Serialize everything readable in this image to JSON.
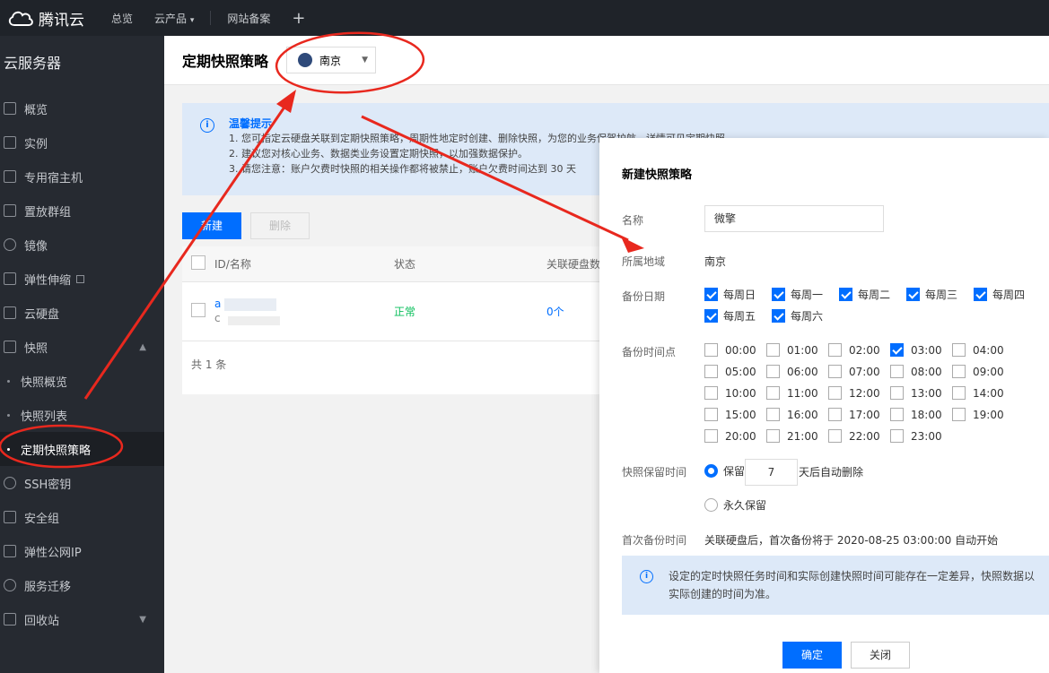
{
  "topbar": {
    "brand": "腾讯云",
    "nav": [
      {
        "label": "总览",
        "icon": ""
      },
      {
        "label": "云产品",
        "icon": "chevron-down-icon"
      },
      {
        "label": "网站备案",
        "icon": ""
      }
    ],
    "plus_icon": "plus-icon"
  },
  "sidebar": {
    "title": "云服务器",
    "items": [
      {
        "label": "概览",
        "icon": "grid-icon"
      },
      {
        "label": "实例",
        "icon": "cube-icon"
      },
      {
        "label": "专用宿主机",
        "icon": "layers-icon"
      },
      {
        "label": "置放群组",
        "icon": "group-icon"
      },
      {
        "label": "镜像",
        "icon": "disc-icon"
      },
      {
        "label": "弹性伸缩",
        "icon": "scale-icon"
      },
      {
        "label": "云硬盘",
        "icon": "disk-icon"
      },
      {
        "label": "快照",
        "icon": "camera-icon"
      }
    ],
    "snapshot_sub": [
      {
        "label": "快照概览"
      },
      {
        "label": "快照列表"
      },
      {
        "label": "定期快照策略"
      }
    ],
    "items_after": [
      {
        "label": "SSH密钥",
        "icon": "key-icon"
      },
      {
        "label": "安全组",
        "icon": "shield-icon"
      },
      {
        "label": "弹性公网IP",
        "icon": "ip-icon"
      },
      {
        "label": "服务迁移",
        "icon": "migrate-icon"
      },
      {
        "label": "回收站",
        "icon": "trash-icon"
      }
    ]
  },
  "page": {
    "title": "定期快照策略",
    "region": "南京"
  },
  "notice": {
    "title": "温馨提示",
    "lines": [
      "1. 您可指定云硬盘关联到定期快照策略，周期性地定时创建、删除快照，为您的业务保驾护航，详情可见定期快照",
      "2. 建议您对核心业务、数据类业务设置定期快照，以加强数据保护。",
      "3. 请您注意：账户欠费时快照的相关操作都将被禁止，账户欠费时间达到 30 天"
    ]
  },
  "actions": {
    "create": "新建",
    "delete": "删除"
  },
  "table": {
    "headers": [
      "ID/名称",
      "状态",
      "关联硬盘数"
    ],
    "rows": [
      {
        "id_prefix": "a",
        "name_prefix": "c",
        "status": "正常",
        "disks": "0个"
      }
    ],
    "footer": "共 1 条"
  },
  "modal": {
    "title": "新建快照策略",
    "name_label": "名称",
    "name_value": "微擎",
    "region_label": "所属地域",
    "region_value": "南京",
    "days_label": "备份日期",
    "days": [
      {
        "label": "每周日",
        "checked": true
      },
      {
        "label": "每周一",
        "checked": true
      },
      {
        "label": "每周二",
        "checked": true
      },
      {
        "label": "每周三",
        "checked": true
      },
      {
        "label": "每周四",
        "checked": true
      },
      {
        "label": "每周五",
        "checked": true
      },
      {
        "label": "每周六",
        "checked": true
      }
    ],
    "time_label": "备份时间点",
    "times": [
      {
        "label": "00:00",
        "checked": false
      },
      {
        "label": "01:00",
        "checked": false
      },
      {
        "label": "02:00",
        "checked": false
      },
      {
        "label": "03:00",
        "checked": true
      },
      {
        "label": "04:00",
        "checked": false
      },
      {
        "label": "05:00",
        "checked": false
      },
      {
        "label": "06:00",
        "checked": false
      },
      {
        "label": "07:00",
        "checked": false
      },
      {
        "label": "08:00",
        "checked": false
      },
      {
        "label": "09:00",
        "checked": false
      },
      {
        "label": "10:00",
        "checked": false
      },
      {
        "label": "11:00",
        "checked": false
      },
      {
        "label": "12:00",
        "checked": false
      },
      {
        "label": "13:00",
        "checked": false
      },
      {
        "label": "14:00",
        "checked": false
      },
      {
        "label": "15:00",
        "checked": false
      },
      {
        "label": "16:00",
        "checked": false
      },
      {
        "label": "17:00",
        "checked": false
      },
      {
        "label": "18:00",
        "checked": false
      },
      {
        "label": "19:00",
        "checked": false
      },
      {
        "label": "20:00",
        "checked": false
      },
      {
        "label": "21:00",
        "checked": false
      },
      {
        "label": "22:00",
        "checked": false
      },
      {
        "label": "23:00",
        "checked": false
      }
    ],
    "retain_label": "快照保留时间",
    "retain_keep": "保留",
    "retain_days": "7",
    "retain_suffix": "天后自动删除",
    "retain_forever": "永久保留",
    "retain_choice": "keep",
    "first_label": "首次备份时间",
    "first_value": "关联硬盘后，首次备份将于 2020-08-25 03:00:00 自动开始",
    "info_line1": "设定的定时快照任务时间和实际创建快照时间可能存在一定差异，快照数据以",
    "info_line2": "实际创建的时间为准。",
    "ok": "确定",
    "close": "关闭"
  },
  "colors": {
    "primary": "#006eff",
    "annotation": "#e8281e",
    "status_ok": "#0abf5b"
  }
}
